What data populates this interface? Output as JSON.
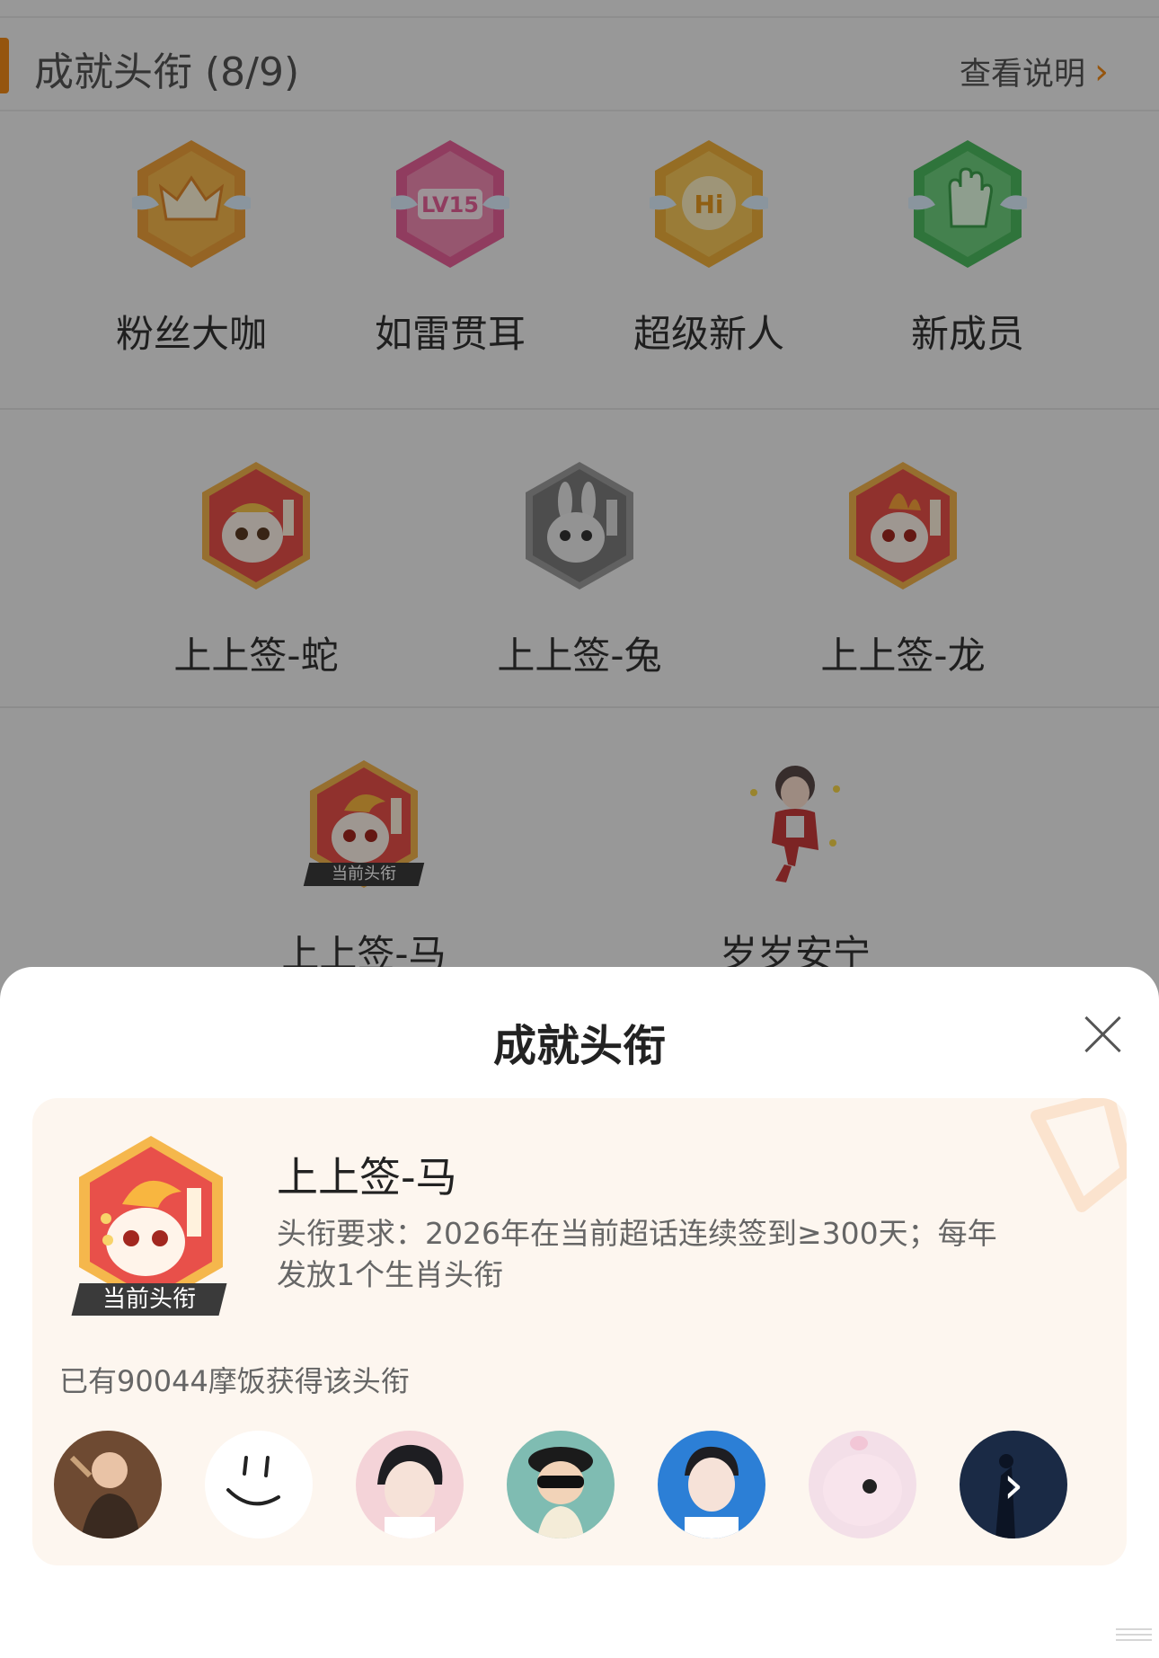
{
  "section": {
    "title": "成就头衔 (8/9)",
    "see_more": "查看说明"
  },
  "badges_row1": [
    {
      "name": "粉丝大咖",
      "icon": "crown-icon",
      "color": "#f2a73a"
    },
    {
      "name": "如雷贯耳",
      "icon": "lv15-icon",
      "color": "#ee6f9c"
    },
    {
      "name": "超级新人",
      "icon": "hi-icon",
      "color": "#f3b43f"
    },
    {
      "name": "新成员",
      "icon": "hand-icon",
      "color": "#58c86c"
    }
  ],
  "badges_row2": [
    {
      "name": "上上签-蛇",
      "icon": "snake-icon",
      "color": "#ef7a52"
    },
    {
      "name": "上上签-兔",
      "icon": "rabbit-icon",
      "color": "#a8a8a8"
    },
    {
      "name": "上上签-龙",
      "icon": "dragon-icon",
      "color": "#ef7a52"
    }
  ],
  "badges_row3": [
    {
      "name": "上上签-马",
      "icon": "horse-icon",
      "color": "#ef7a52",
      "tag": "当前头衔"
    },
    {
      "name": "岁岁安宁",
      "icon": "figure-icon",
      "color": "#c93b3b"
    }
  ],
  "sheet": {
    "title": "成就头衔",
    "badge_name": "上上签-马",
    "badge_tag": "当前头衔",
    "requirement": "头衔要求：2026年在当前超话连续签到≥300天；每年发放1个生肖头衔",
    "count_text": "已有90044摩饭获得该头衔"
  },
  "avatars": [
    {
      "icon": "avatar-singer",
      "bg": "#6e4a32"
    },
    {
      "icon": "avatar-smiley",
      "bg": "#ffffff"
    },
    {
      "icon": "avatar-portrait-pink",
      "bg": "#f4d3d8"
    },
    {
      "icon": "avatar-cartoon-glasses",
      "bg": "#7fbcb2"
    },
    {
      "icon": "avatar-portrait-blue",
      "bg": "#2c7fd6"
    },
    {
      "icon": "avatar-pink-pig",
      "bg": "#f3dfe8"
    },
    {
      "icon": "avatar-more",
      "bg": "#1a2a45"
    }
  ]
}
